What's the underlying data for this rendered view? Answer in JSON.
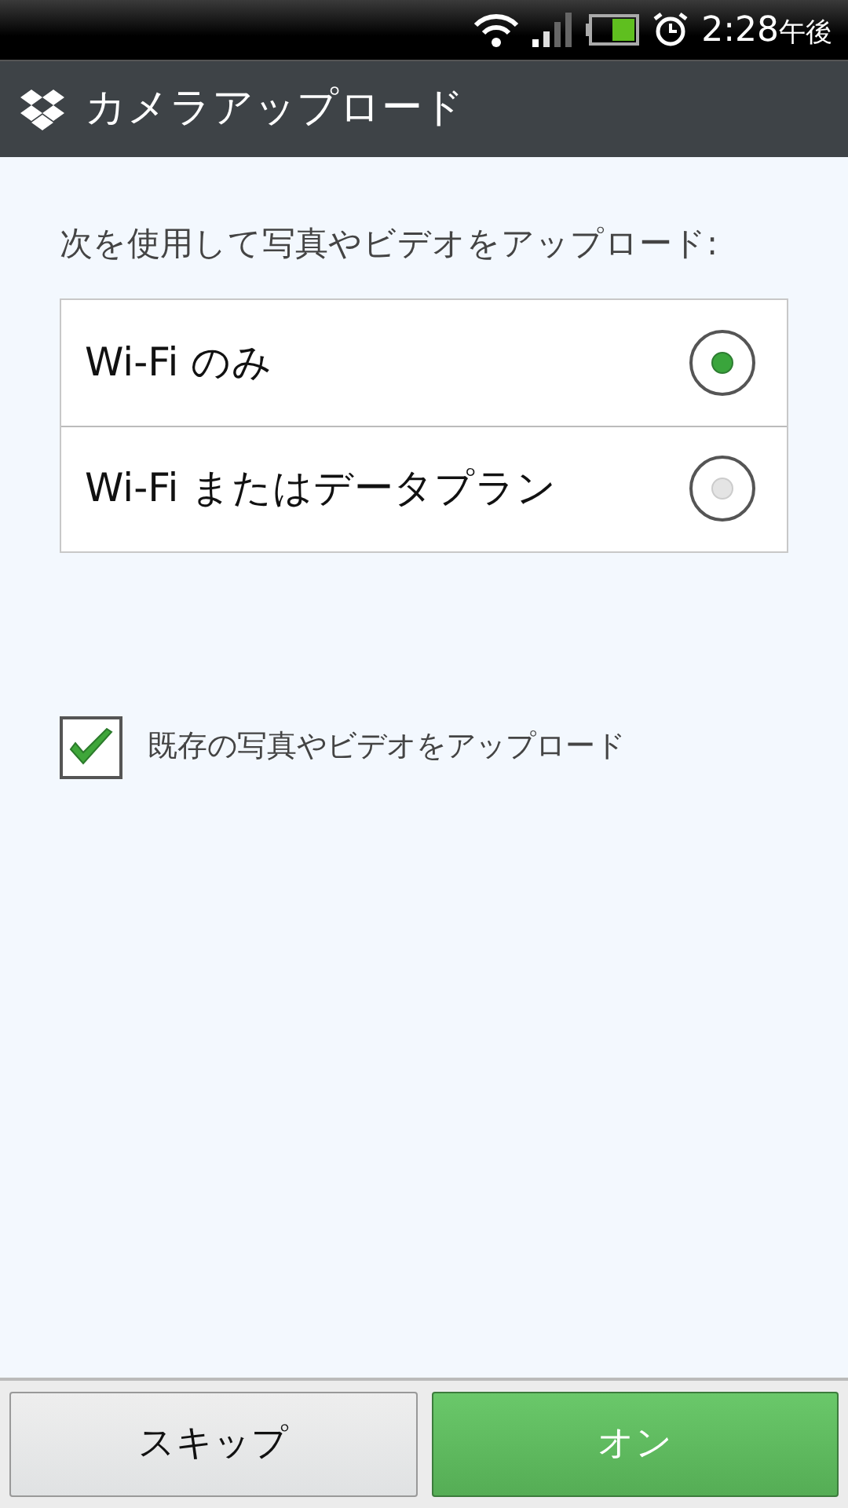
{
  "status_bar": {
    "time": "2:28",
    "period": "午後"
  },
  "title_bar": {
    "title": "カメラアップロード"
  },
  "prompt": "次を使用して写真やビデオをアップロード:",
  "options": [
    {
      "label": "Wi-Fi のみ",
      "selected": true
    },
    {
      "label": "Wi-Fi またはデータプラン",
      "selected": false
    }
  ],
  "existing_upload": {
    "label": "既存の写真やビデオをアップロード",
    "checked": true
  },
  "buttons": [
    {
      "label": "スキップ",
      "kind": "secondary"
    },
    {
      "label": "オン",
      "kind": "primary"
    }
  ]
}
